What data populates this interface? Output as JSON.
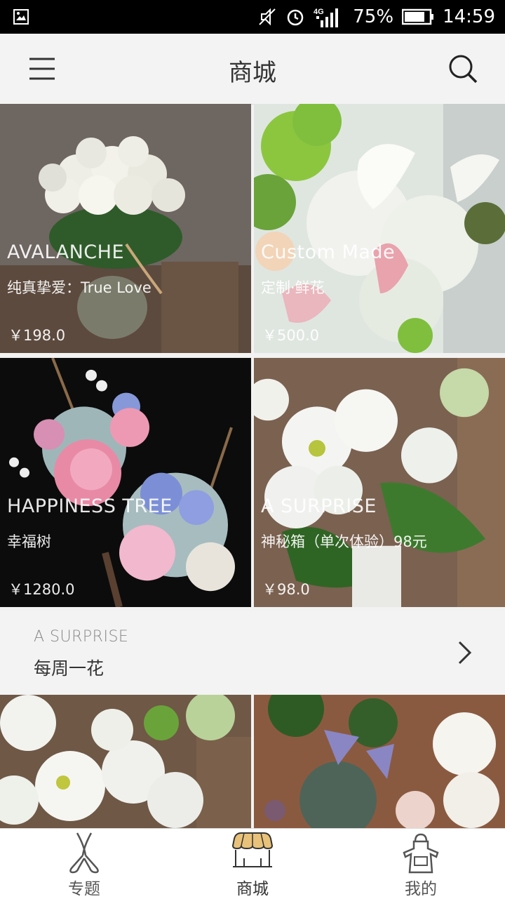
{
  "status_bar": {
    "battery": "75%",
    "time": "14:59",
    "network": "4G"
  },
  "header": {
    "title": "商城"
  },
  "products": [
    {
      "en": "AVALANCHE",
      "cn": "纯真挚爱：True Love",
      "price": "￥198.0"
    },
    {
      "en": "Custom Made",
      "cn": "定制·鲜花",
      "price": "￥500.0"
    },
    {
      "en": "HAPPINESS TREE",
      "cn": "幸福树",
      "price": "￥1280.0"
    },
    {
      "en": "A SURPRISE",
      "cn": "神秘箱（单次体验）98元",
      "price": "￥98.0"
    }
  ],
  "banner": {
    "en": "A SURPRISE",
    "cn": "每周一花"
  },
  "tabs": [
    {
      "label": "专题",
      "icon": "scissors-icon",
      "active": false
    },
    {
      "label": "商城",
      "icon": "shop-icon",
      "active": true
    },
    {
      "label": "我的",
      "icon": "apron-icon",
      "active": false
    }
  ],
  "colors": {
    "accent": "#e8c27a",
    "header_bg": "#f3f3f3",
    "status_bg": "#000000"
  }
}
